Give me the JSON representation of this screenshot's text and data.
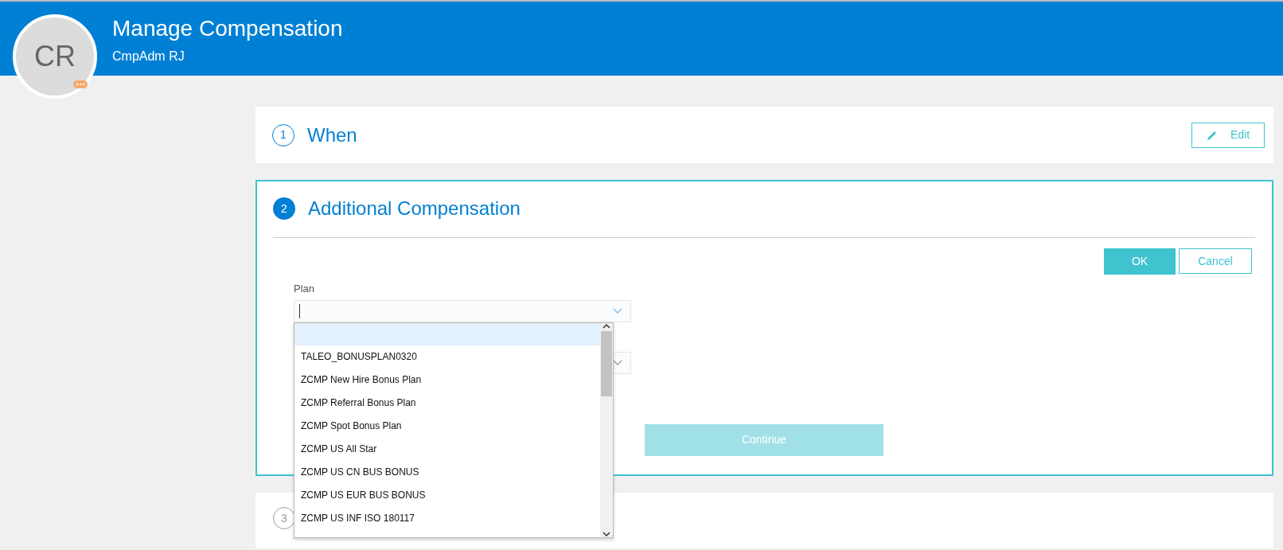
{
  "header": {
    "title": "Manage Compensation",
    "subtitle": "CmpAdm RJ",
    "avatar": {
      "initials": "CR"
    }
  },
  "steps": [
    {
      "number": "1",
      "title": "When",
      "kind": "done",
      "action": "Edit"
    },
    {
      "number": "2",
      "title": "Additional Compensation",
      "kind": "active",
      "buttons": {
        "ok": "OK",
        "cancel": "Cancel"
      },
      "plan_field": {
        "label": "Plan",
        "expanded": true,
        "options": [
          {
            "label": "TALEO_BONUSPLAN0320",
            "selected": false
          },
          {
            "label": "ZCMP New Hire Bonus Plan",
            "selected": false
          },
          {
            "label": "ZCMP Referral Bonus Plan",
            "selected": false
          },
          {
            "label": "ZCMP Spot Bonus Plan",
            "selected": false
          },
          {
            "label": "ZCMP US All Star",
            "selected": false
          },
          {
            "label": "ZCMP US CN BUS BONUS",
            "selected": false
          },
          {
            "label": "ZCMP US EUR BUS BONUS",
            "selected": false
          },
          {
            "label": "ZCMP US INF ISO 180117",
            "selected": false
          }
        ]
      },
      "continue": {
        "label": "Continue",
        "disabled": true
      }
    },
    {
      "number": "3",
      "kind": "pending"
    }
  ]
}
